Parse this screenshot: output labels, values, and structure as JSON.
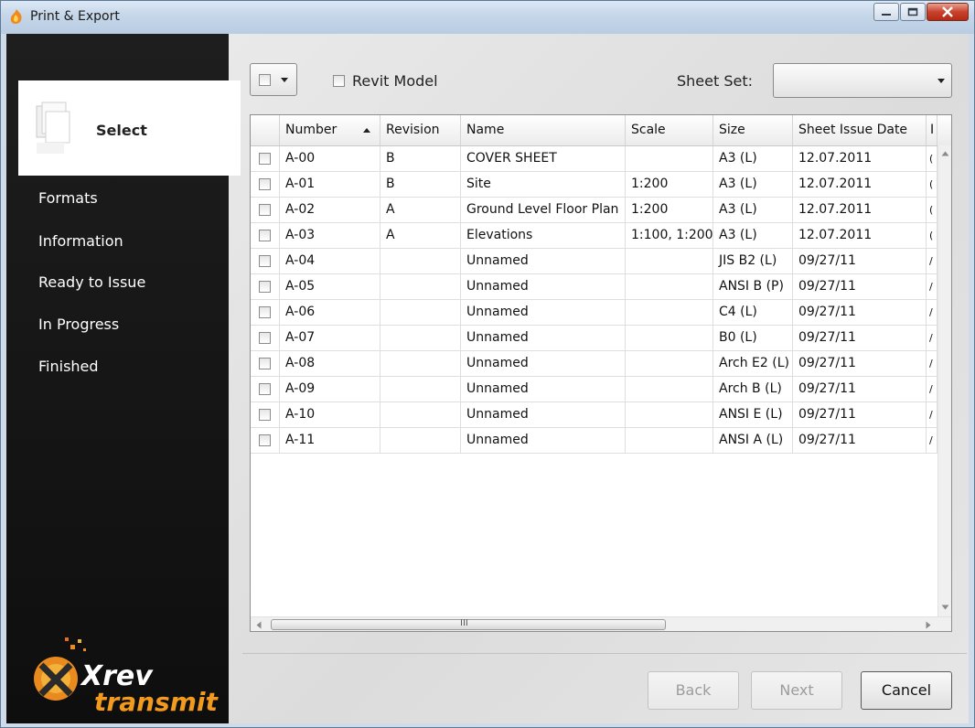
{
  "window": {
    "title": "Print & Export",
    "icon": "xrev-flame-icon"
  },
  "sidebar": {
    "selected": "Select",
    "items": [
      "Formats",
      "Information",
      "Ready to Issue",
      "In Progress",
      "Finished"
    ],
    "logo": {
      "line1": "Xrev",
      "line2": "transmit"
    }
  },
  "toolbar": {
    "revit_model_label": "Revit Model",
    "sheet_set_label": "Sheet Set:",
    "sheet_set_value": ""
  },
  "table": {
    "columns": [
      "",
      "Number",
      "Revision",
      "Name",
      "Scale",
      "Size",
      "Sheet Issue Date",
      "I"
    ],
    "sort": {
      "column": "Number",
      "direction": "ascending"
    },
    "rows": [
      {
        "number": "A-00",
        "revision": "B",
        "name": "COVER SHEET",
        "scale": "",
        "size": "A3 (L)",
        "date": "12.07.2011",
        "extra": "("
      },
      {
        "number": "A-01",
        "revision": "B",
        "name": "Site",
        "scale": "1:200",
        "size": "A3 (L)",
        "date": "12.07.2011",
        "extra": "("
      },
      {
        "number": "A-02",
        "revision": "A",
        "name": "Ground Level Floor Plan",
        "scale": "1:200",
        "size": "A3 (L)",
        "date": "12.07.2011",
        "extra": "("
      },
      {
        "number": "A-03",
        "revision": "A",
        "name": "Elevations",
        "scale": "1:100, 1:200",
        "size": "A3 (L)",
        "date": "12.07.2011",
        "extra": "("
      },
      {
        "number": "A-04",
        "revision": "",
        "name": "Unnamed",
        "scale": "",
        "size": "JIS B2 (L)",
        "date": "09/27/11",
        "extra": "/"
      },
      {
        "number": "A-05",
        "revision": "",
        "name": "Unnamed",
        "scale": "",
        "size": "ANSI B (P)",
        "date": "09/27/11",
        "extra": "/"
      },
      {
        "number": "A-06",
        "revision": "",
        "name": "Unnamed",
        "scale": "",
        "size": "C4 (L)",
        "date": "09/27/11",
        "extra": "/"
      },
      {
        "number": "A-07",
        "revision": "",
        "name": "Unnamed",
        "scale": "",
        "size": "B0 (L)",
        "date": "09/27/11",
        "extra": "/"
      },
      {
        "number": "A-08",
        "revision": "",
        "name": "Unnamed",
        "scale": "",
        "size": "Arch E2 (L)",
        "date": "09/27/11",
        "extra": "/"
      },
      {
        "number": "A-09",
        "revision": "",
        "name": "Unnamed",
        "scale": "",
        "size": "Arch B (L)",
        "date": "09/27/11",
        "extra": "/"
      },
      {
        "number": "A-10",
        "revision": "",
        "name": "Unnamed",
        "scale": "",
        "size": "ANSI E (L)",
        "date": "09/27/11",
        "extra": "/"
      },
      {
        "number": "A-11",
        "revision": "",
        "name": "Unnamed",
        "scale": "",
        "size": "ANSI A (L)",
        "date": "09/27/11",
        "extra": "/"
      }
    ],
    "hscroll_grip": "III"
  },
  "buttons": {
    "back": "Back",
    "next": "Next",
    "cancel": "Cancel"
  },
  "colors": {
    "sidebar_bg": "#141414",
    "close_button": "#c8422d"
  }
}
